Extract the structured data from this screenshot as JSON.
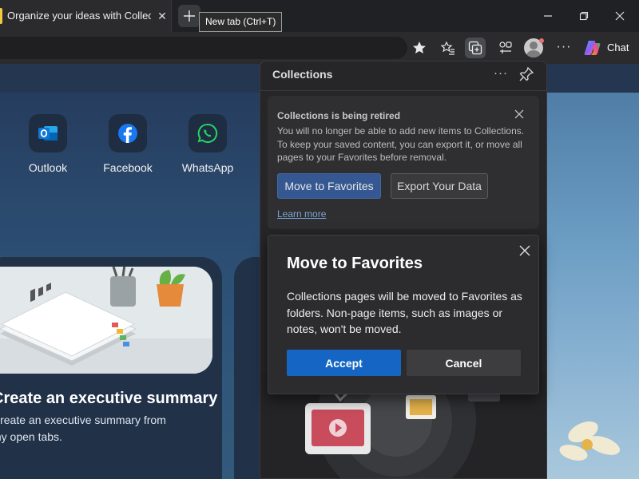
{
  "tab": {
    "title": "Organize your ideas with Collections",
    "close_glyph": "✕",
    "accent_color": "#f2c744"
  },
  "tooltip": {
    "text": "New tab (Ctrl+T)"
  },
  "toolbar": {
    "chat_label": "Chat",
    "more_glyph": "···",
    "icons": [
      "favorite-star-icon",
      "favorites-list-icon",
      "collections-icon",
      "extensions-icon",
      "profile-avatar",
      "more-options-icon",
      "copilot-icon"
    ]
  },
  "quick_links": [
    {
      "label": "Outlook",
      "icon": "outlook-icon",
      "color": "#0f78d4"
    },
    {
      "label": "Facebook",
      "icon": "facebook-icon",
      "color": "#1877f2"
    },
    {
      "label": "WhatsApp",
      "icon": "whatsapp-icon",
      "color": "#25d366"
    }
  ],
  "card": {
    "title": "Create an executive summary",
    "text": "Create an executive summary from my open tabs."
  },
  "collections": {
    "title": "Collections",
    "more_glyph": "···",
    "notice": {
      "title": "Collections is being retired",
      "text": "You will no longer be able to add new items to Collections. To keep your saved content, you can export it, or move all pages to your Favorites before removal.",
      "move_button": "Move to Favorites",
      "export_button": "Export Your Data",
      "learn_more": "Learn more"
    }
  },
  "dialog": {
    "title": "Move to Favorites",
    "text": "Collections pages will be moved to Favorites as folders. Non-page items, such as images or notes, won't be moved.",
    "accept": "Accept",
    "cancel": "Cancel",
    "accept_color": "#1566c4"
  }
}
